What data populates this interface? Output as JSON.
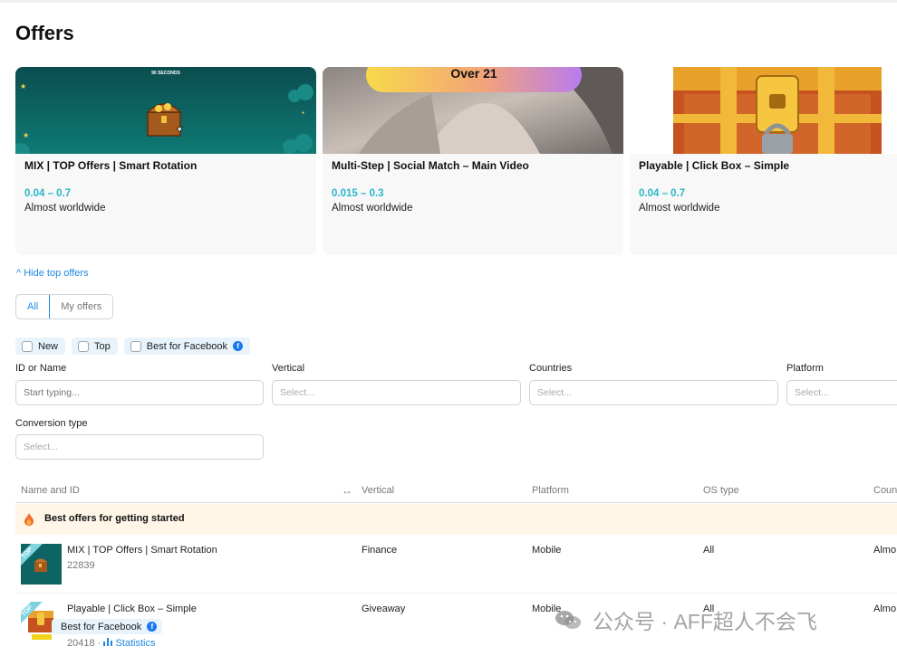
{
  "page": {
    "title": "Offers"
  },
  "top_offers": [
    {
      "title": "MIX | TOP Offers | Smart Rotation",
      "payout": "0.04 – 0.7",
      "geo": "Almost worldwide",
      "banner_text": "SECONDS"
    },
    {
      "title": "Multi-Step | Social Match – Main Video",
      "payout": "0.015 – 0.3",
      "geo": "Almost worldwide",
      "banner_text": "Over 21"
    },
    {
      "title": "Playable | Click Box – Simple",
      "payout": "0.04 – 0.7",
      "geo": "Almost worldwide"
    }
  ],
  "hide_top_offers": "^ Hide top offers",
  "tabs": {
    "all": "All",
    "my_offers": "My offers"
  },
  "chips": {
    "new": "New",
    "top": "Top",
    "best_facebook": "Best for Facebook"
  },
  "filters": {
    "id_or_name": {
      "label": "ID or Name",
      "placeholder": "Start typing..."
    },
    "vertical": {
      "label": "Vertical",
      "placeholder": "Select..."
    },
    "countries": {
      "label": "Countries",
      "placeholder": "Select..."
    },
    "platform": {
      "label": "Platform",
      "placeholder": "Select..."
    },
    "conversion_type": {
      "label": "Conversion type",
      "placeholder": "Select..."
    }
  },
  "table": {
    "columns": {
      "name": "Name and ID",
      "vertical": "Vertical",
      "platform": "Platform",
      "os": "OS type",
      "countries": "Coun"
    },
    "section_title": "Best offers for getting started",
    "rows": [
      {
        "tag": "TOP",
        "name": "MIX | TOP Offers | Smart Rotation",
        "id": "22839",
        "vertical": "Finance",
        "platform": "Mobile",
        "os": "All",
        "countries": "Almo"
      },
      {
        "tag": "TOP",
        "name": "Playable | Click Box – Simple",
        "badge": "Best for Facebook",
        "id": "20418 · ",
        "stats": "Statistics",
        "vertical": "Giveaway",
        "platform": "Mobile",
        "os": "All",
        "countries": "Almo"
      }
    ]
  },
  "watermark": "公众号 · AFF超人不会飞",
  "colors": {
    "accent": "#1e88e5",
    "payout": "#2bb6c9",
    "highlight_row": "#fff6e8",
    "facebook": "#1877f2"
  }
}
